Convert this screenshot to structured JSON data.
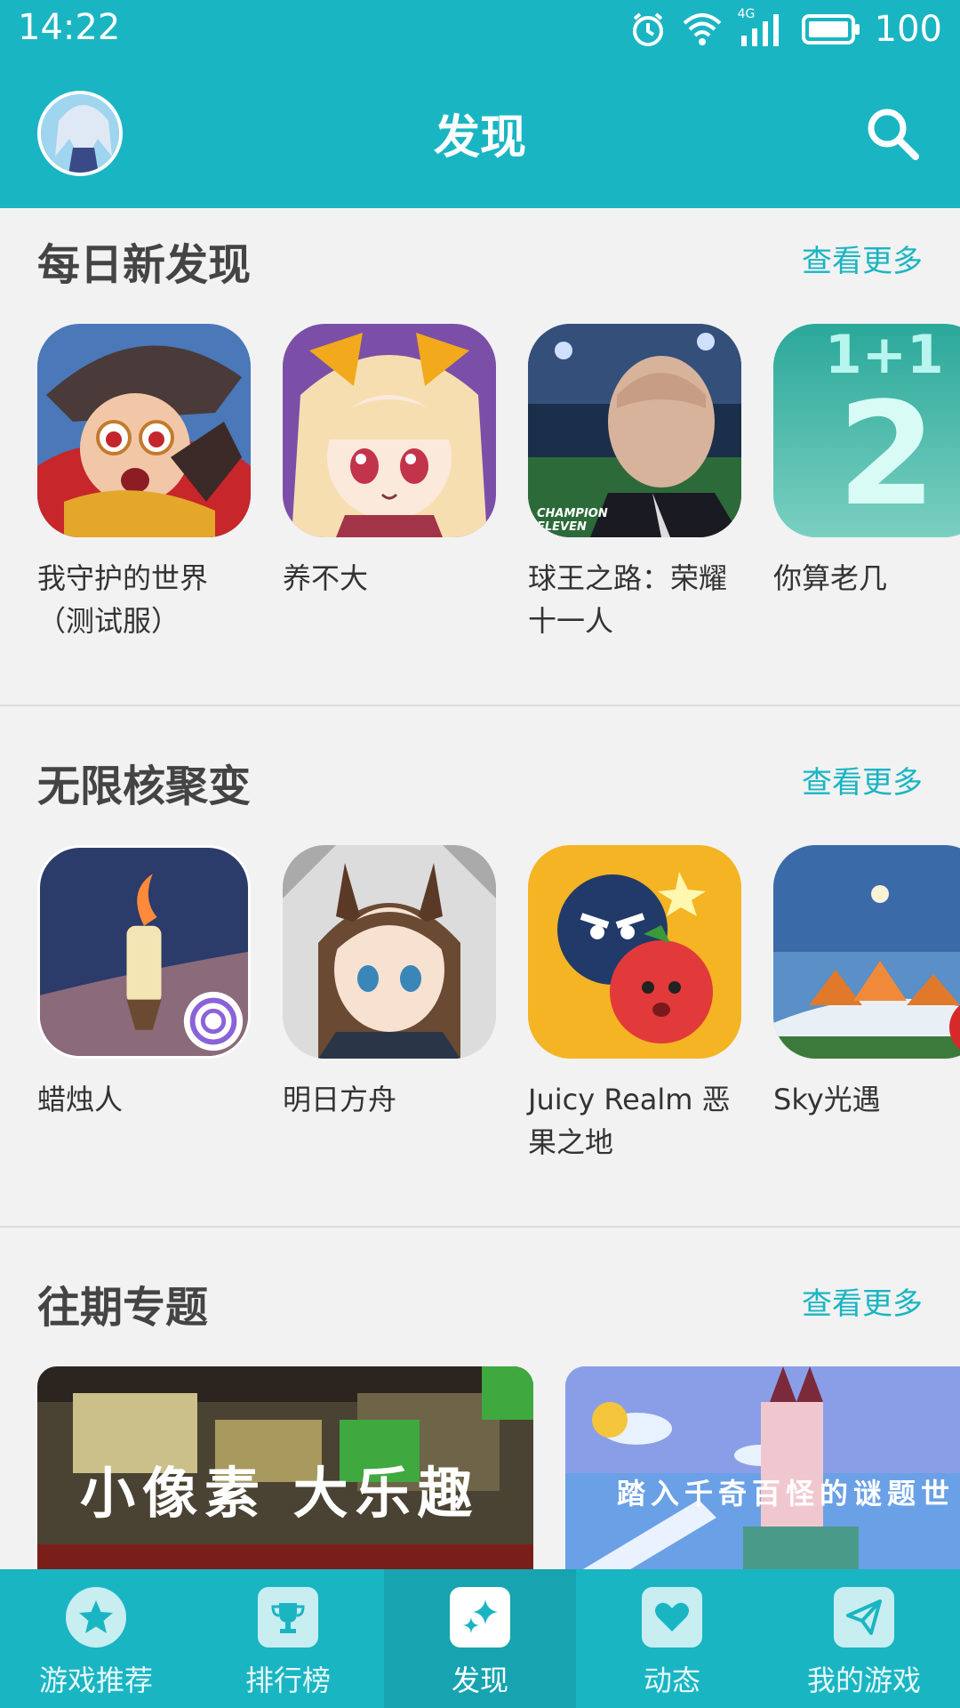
{
  "status_bar": {
    "time": "14:22",
    "signal_label": "4G",
    "battery": "100",
    "icons": [
      "alarm-icon",
      "wifi-icon",
      "cellular-signal-icon",
      "battery-icon"
    ]
  },
  "header": {
    "title": "发现",
    "avatar": "user-avatar",
    "search_icon": "search-icon"
  },
  "sections": [
    {
      "title": "每日新发现",
      "more": "查看更多",
      "apps": [
        {
          "name": "我守护的世界（测试服）"
        },
        {
          "name": "养不大"
        },
        {
          "name": "球王之路：荣耀十一人",
          "icon_text": "CHAMPION ELEVEN"
        },
        {
          "name": "你算老几",
          "icon_text_top": "1+1",
          "icon_text_big": "2"
        }
      ]
    },
    {
      "title": "无限核聚变",
      "more": "查看更多",
      "apps": [
        {
          "name": "蜡烛人"
        },
        {
          "name": "明日方舟"
        },
        {
          "name": "Juicy Realm 恶果之地"
        },
        {
          "name": "Sky光遇"
        }
      ]
    },
    {
      "title": "往期专题",
      "more": "查看更多",
      "topics": [
        {
          "caption": "小像素 大乐趣"
        },
        {
          "caption": "踏入千奇百怪的谜题世"
        }
      ]
    }
  ],
  "tabbar": {
    "tabs": [
      {
        "label": "游戏推荐",
        "icon": "star-icon"
      },
      {
        "label": "排行榜",
        "icon": "trophy-icon"
      },
      {
        "label": "发现",
        "icon": "sparkle-icon",
        "active": true
      },
      {
        "label": "动态",
        "icon": "heart-icon"
      },
      {
        "label": "我的游戏",
        "icon": "paper-plane-icon"
      }
    ]
  },
  "colors": {
    "brand": "#1ab5c3",
    "brand_dark": "#17a3b0",
    "background": "#f2f2f2",
    "link": "#1ab5c3"
  }
}
